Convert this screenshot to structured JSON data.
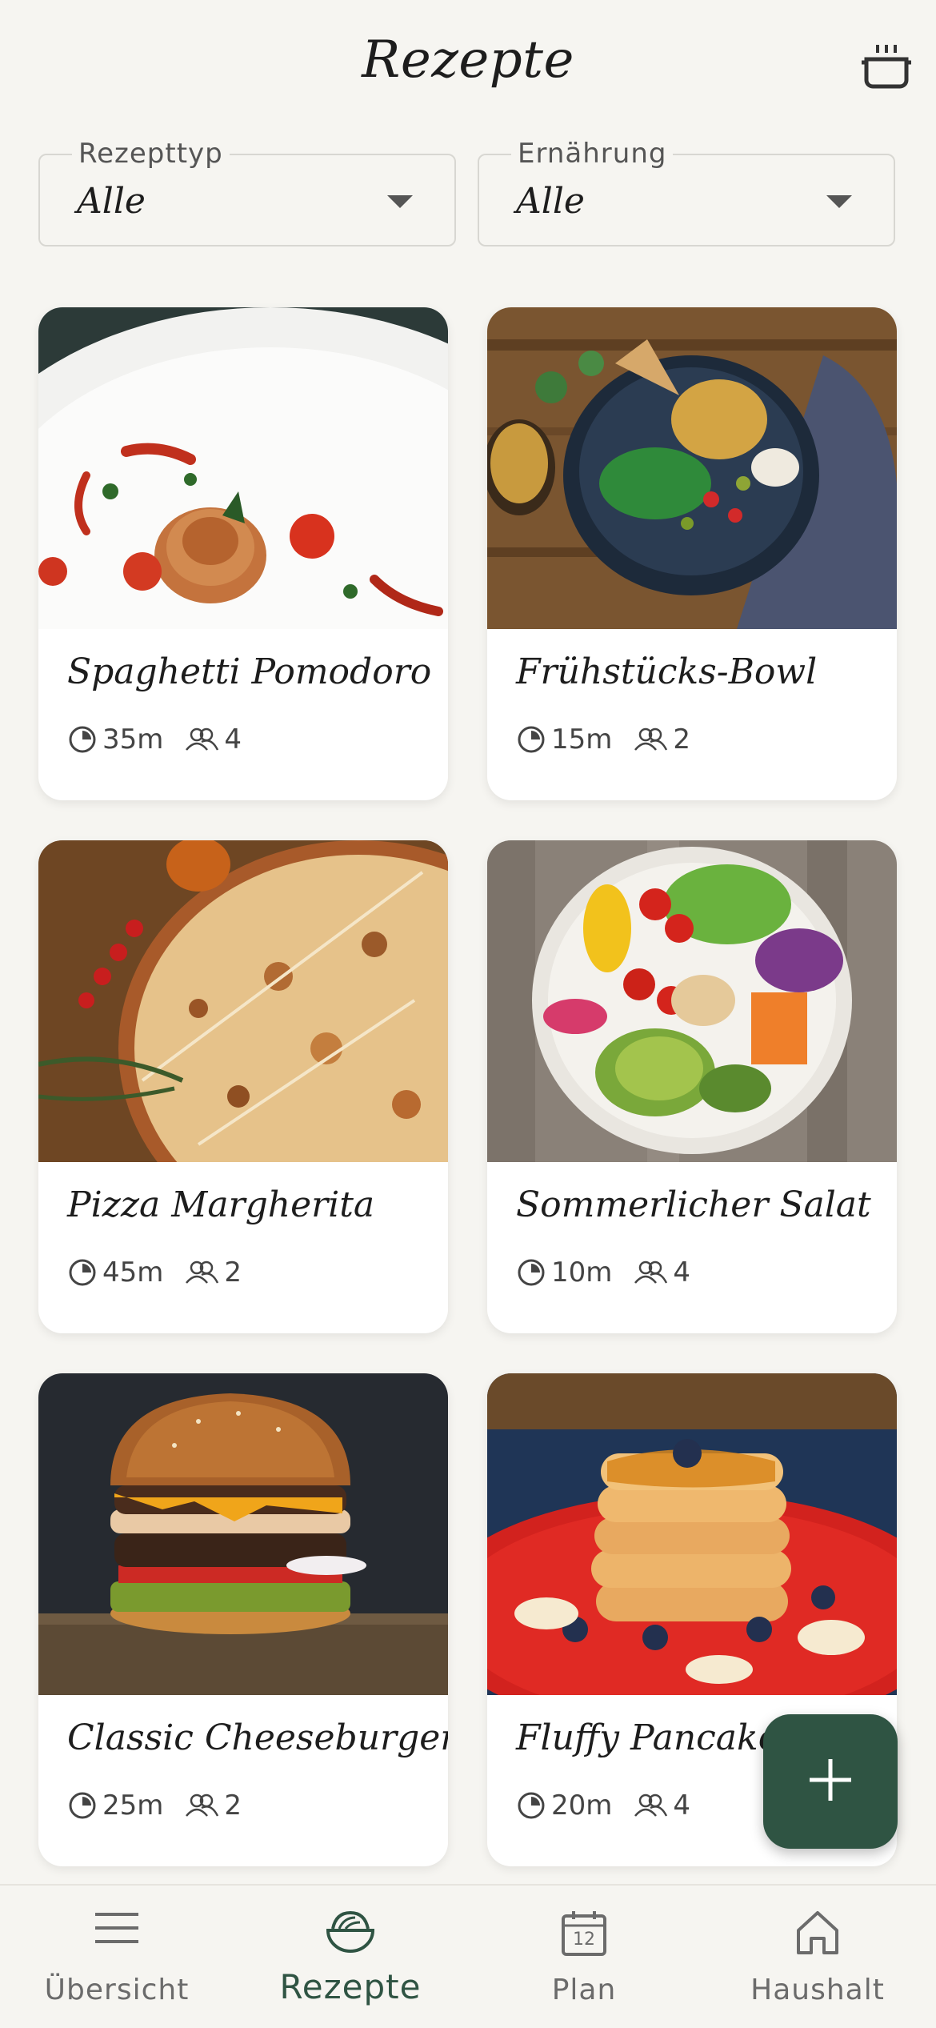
{
  "header": {
    "title": "Rezepte",
    "action_icon": "cooking-pot-icon"
  },
  "filters": [
    {
      "label": "Rezepttyp",
      "value": "Alle"
    },
    {
      "label": "Ernährung",
      "value": "Alle"
    }
  ],
  "recipes": [
    {
      "name": "Spaghetti Pomodoro",
      "time": "35m",
      "servings": "4"
    },
    {
      "name": "Frühstücks-Bowl",
      "time": "15m",
      "servings": "2"
    },
    {
      "name": "Pizza Margherita",
      "time": "45m",
      "servings": "2"
    },
    {
      "name": "Sommerlicher Salat",
      "time": "10m",
      "servings": "4"
    },
    {
      "name": "Classic Cheeseburger",
      "time": "25m",
      "servings": "2"
    },
    {
      "name": "Fluffy Pancakes",
      "time": "20m",
      "servings": "4"
    }
  ],
  "fab": {
    "icon": "plus-icon"
  },
  "nav": {
    "items": [
      {
        "label": "Übersicht",
        "icon": "menu-icon"
      },
      {
        "label": "Rezepte",
        "icon": "bowl-icon",
        "active": true
      },
      {
        "label": "Plan",
        "icon": "calendar-icon",
        "badge": "12"
      },
      {
        "label": "Haushalt",
        "icon": "home-icon"
      }
    ]
  },
  "colors": {
    "accent": "#2f5443",
    "background": "#f6f5f1",
    "card": "#ffffff"
  }
}
